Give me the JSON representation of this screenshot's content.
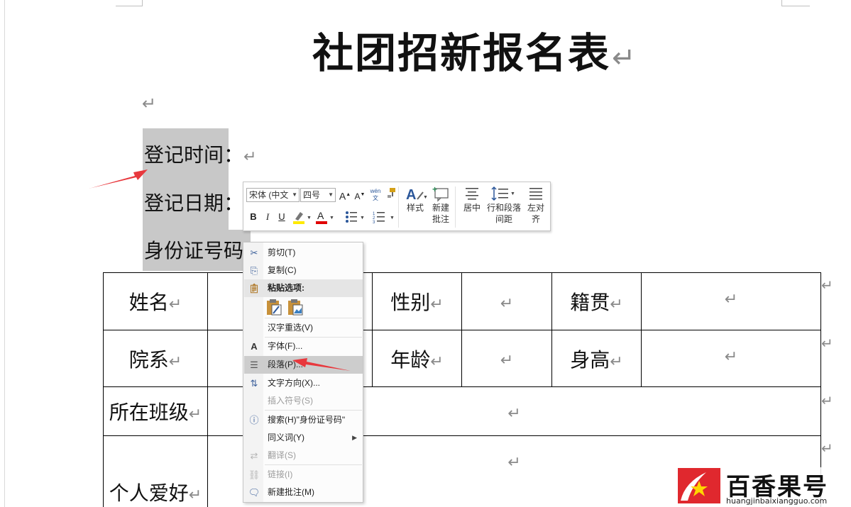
{
  "document": {
    "title": "社团招新报名表",
    "pilcrow": "↵",
    "paragraphs": [
      {
        "text": "登记时间："
      },
      {
        "text": "登记日期："
      },
      {
        "text": "身份证号码"
      }
    ],
    "table": {
      "rows": [
        [
          "姓名",
          "",
          "",
          "性别",
          "",
          "籍贯",
          ""
        ],
        [
          "院系",
          "",
          "",
          "年龄",
          "",
          "身高",
          ""
        ],
        [
          "所在班级",
          ""
        ],
        [
          "个人爱好",
          ""
        ]
      ]
    }
  },
  "mini_toolbar": {
    "font_name": "宋体 (中文",
    "font_size": "四号",
    "grow_font": "A",
    "shrink_font": "A",
    "phonetic": "wén文",
    "bold": "B",
    "italic": "I",
    "underline": "U",
    "font_color": "A",
    "styles_label": "样式",
    "new_comment_label_1": "新建",
    "new_comment_label_2": "批注",
    "center_label": "居中",
    "line_spacing_label_1": "行和段落",
    "line_spacing_label_2": "间距",
    "align_left_label_1": "左对",
    "align_left_label_2": "齐"
  },
  "context_menu": {
    "items": [
      {
        "label": "剪切(T)",
        "icon": "scissors-icon",
        "enabled": true
      },
      {
        "label": "复制(C)",
        "icon": "copy-icon",
        "enabled": true
      },
      {
        "label": "粘贴选项:",
        "icon": "paste-icon",
        "enabled": true,
        "header": true
      },
      {
        "label": "汉字重选(V)",
        "icon": "",
        "enabled": true
      },
      {
        "label": "字体(F)...",
        "icon": "font-icon",
        "enabled": true
      },
      {
        "label": "段落(P)...",
        "icon": "paragraph-icon",
        "enabled": true,
        "highlighted": true
      },
      {
        "label": "文字方向(X)...",
        "icon": "text-direction-icon",
        "enabled": true
      },
      {
        "label": "插入符号(S)",
        "icon": "",
        "enabled": false
      },
      {
        "label": "搜索(H)\"身份证号码\"",
        "icon": "search-icon",
        "enabled": true
      },
      {
        "label": "同义词(Y)",
        "icon": "",
        "enabled": true,
        "submenu": true
      },
      {
        "label": "翻译(S)",
        "icon": "translate-icon",
        "enabled": false
      },
      {
        "label": "链接(I)",
        "icon": "link-icon",
        "enabled": false
      },
      {
        "label": "新建批注(M)",
        "icon": "new-comment-icon",
        "enabled": true
      }
    ]
  },
  "watermark": {
    "brand": "百香果号",
    "url": "huangjinbaixiangguo.com"
  },
  "colors": {
    "selection": "#c8c8c8",
    "annotation_arrow": "#e8383d",
    "menu_highlight": "#cdcdcd",
    "watermark_red": "#e0282e"
  }
}
